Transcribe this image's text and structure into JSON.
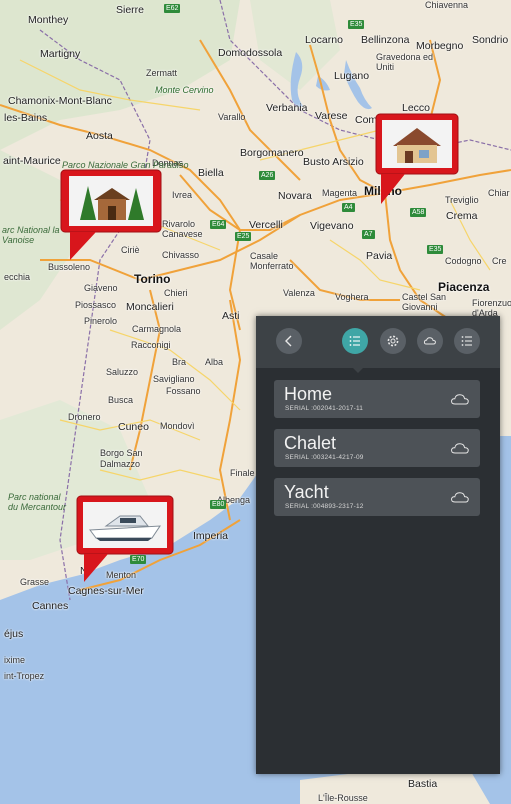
{
  "map": {
    "cities": [
      "Sierre",
      "Monthey",
      "Martigny",
      "Zermatt",
      "Monte Cervino",
      "Domodossola",
      "Locarno",
      "Bellinzona",
      "Morbegno",
      "Sondrio",
      "Gravedona ed Uniti",
      "Lugano",
      "Chamonix-Mont-Blanc",
      "les-Bains",
      "Varallo",
      "Verbania",
      "Varese",
      "Como",
      "Lecco",
      "Aosta",
      "aint-Maurice",
      "Borgomanero",
      "Busto Arsizio",
      "Donnas",
      "Biella",
      "Ivrea",
      "Novara",
      "Magenta",
      "Milano",
      "Rivarolo Canavese",
      "Vercelli",
      "Vigevano",
      "Treviglio",
      "Crema",
      "Chivasso",
      "Ciriè",
      "Bussoleno",
      "Casale Monferrato",
      "Pavia",
      "Codogno",
      "Cre",
      "Torino",
      "Chieri",
      "Piacenza",
      "Giaveno",
      "Valenza",
      "Voghera",
      "Castel San Giovanni",
      "Fiorenzuola d'Arda",
      "Piossasco",
      "Moncalieri",
      "Asti",
      "Pinerolo",
      "Carmagnola",
      "Racconigi",
      "Bra",
      "Alba",
      "Saluzzo",
      "Savigliano",
      "Fossano",
      "Busca",
      "Dronero",
      "Cuneo",
      "Mondovì",
      "Borgo San Dalmazzo",
      "Finale",
      "Albenga",
      "Imperia",
      "Menton",
      "Cagnes-sur-Mer",
      "Grasse",
      "Cannes",
      "Ni",
      "éjus",
      "ixime",
      "int-Tropez",
      "L'Île-Rousse",
      "Bastia",
      "Chiavenna",
      "ecchia",
      "Chiar"
    ],
    "parks": [
      "Parco Nazionale Gran Paradiso",
      "arc National la Vanoise",
      "Parc national du Mercantour"
    ],
    "highways": [
      "E35",
      "E62",
      "A26",
      "A4",
      "A58",
      "E64",
      "E25",
      "A7",
      "E35",
      "E70",
      "E80"
    ]
  },
  "markers": [
    {
      "name": "Home",
      "icon": "house-icon"
    },
    {
      "name": "Chalet",
      "icon": "chalet-icon"
    },
    {
      "name": "Yacht",
      "icon": "yacht-icon"
    }
  ],
  "panel": {
    "toolbar": [
      "back-icon",
      "list-icon",
      "settings-icon",
      "cloud-icon",
      "menu-icon"
    ],
    "devices": [
      {
        "name": "Home",
        "serial": "SERIAL :002041-2017-11"
      },
      {
        "name": "Chalet",
        "serial": "SERIAL :003241-4217-09"
      },
      {
        "name": "Yacht",
        "serial": "SERIAL :004893-2317-12"
      }
    ]
  },
  "colors": {
    "accent": "#3fa6a6",
    "panel": "#2b2f33",
    "toolbar": "#3d4246",
    "card": "#4d5257",
    "marker": "#d8161c",
    "sea": "#a4c3e8",
    "land": "#efe9dc"
  }
}
